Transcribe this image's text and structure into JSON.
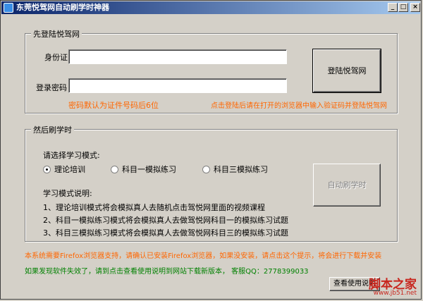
{
  "window": {
    "title": "东莞悦驾网自动刷学时神器",
    "controls": {
      "minimize": "_",
      "maximize": "□",
      "close": "×"
    }
  },
  "login_group": {
    "title": "先登陆悦驾网",
    "id_label": "身份证",
    "id_value": "",
    "password_label": "登录密码",
    "password_value": "",
    "login_button": "登陆悦驾网",
    "hint_password": "密码默认为证件号码后6位",
    "hint_login": "点击登陆后请在打开的浏览器中输入验证码并登陆悦驾网"
  },
  "study_group": {
    "title": "然后刷学时",
    "mode_prompt": "请选择学习模式:",
    "modes": [
      {
        "label": "理论培训",
        "checked": true
      },
      {
        "label": "科目一模拟练习",
        "checked": false
      },
      {
        "label": "科目三模拟练习",
        "checked": false
      }
    ],
    "auto_button": "自动刷学时",
    "desc_title": "学习模式说明:",
    "desc_lines": [
      "1、理论培训模式将会模拟真人去随机点击驾悦网里面的视频课程",
      "2、科目一模拟练习模式将会模拟真人去做驾悦网科目一的模拟练习试题",
      "3、科目三模拟练习模式将会模拟真人去做驾悦网科目三的模拟练习试题"
    ]
  },
  "footer": {
    "firefox_notice": "本系统需要Firefox浏览器支持，请确认已安装Firefox浏览器，如果没安装，请点击这个提示，将会进行下载并安装",
    "update_notice": "如果发现软件失效了，请到点击查看使用说明到网站下载新版本，  客服QQ：2778399033",
    "help_button": "查看使用说明"
  },
  "watermark": {
    "text": "脚本之家",
    "url": "www.jb51.net"
  }
}
